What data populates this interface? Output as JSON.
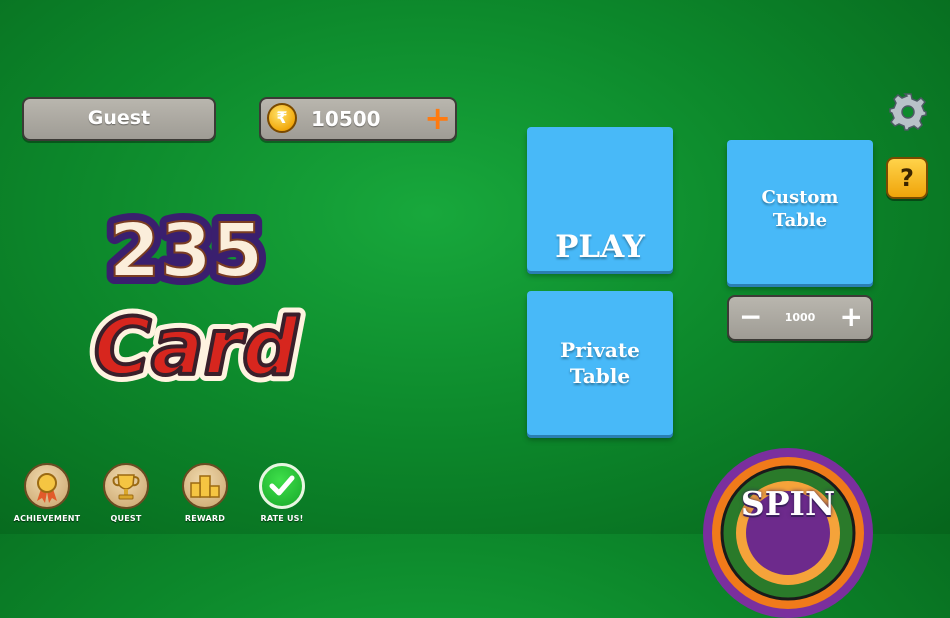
{
  "header": {
    "player_name": "Guest",
    "coins": "10500",
    "coin_symbol": "₹",
    "add_coins": "+"
  },
  "logo": {
    "line1": "235",
    "line2": "Card"
  },
  "tiles": {
    "play": "PLAY",
    "private": "Private\nTable",
    "custom": "Custom\nTable"
  },
  "stepper": {
    "minus": "−",
    "value": "1000",
    "plus": "+"
  },
  "side_buttons": {
    "settings_icon": "gear-icon",
    "help": "?"
  },
  "bottom_nav": [
    {
      "label": "ACHIEVEMENT",
      "icon": "medal-icon"
    },
    {
      "label": "QUEST",
      "icon": "trophy-icon"
    },
    {
      "label": "REWARD",
      "icon": "podium-icon"
    },
    {
      "label": "RATE US!",
      "icon": "checkmark-icon"
    }
  ],
  "spin": {
    "label": "SPIN"
  },
  "colors": {
    "felt": "#0d8a2c",
    "tile_blue": "#48b9f8",
    "coin_plus": "#ff7a10",
    "logo_purple": "#3a1f6e",
    "logo_red": "#d7261e"
  }
}
